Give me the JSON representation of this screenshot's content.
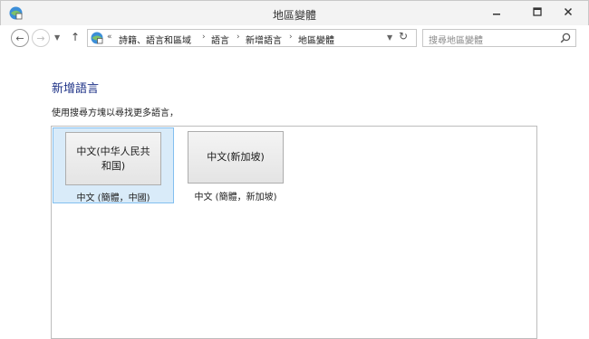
{
  "window": {
    "title": "地區變體"
  },
  "nav": {
    "crumbs": [
      "詩籍、語言和區域",
      "語言",
      "新增語言",
      "地區變體"
    ],
    "search_placeholder": "搜尋地區變體"
  },
  "content": {
    "heading": "新增語言",
    "instructions": "使用搜尋方塊以尋找更多語言，",
    "variants": [
      {
        "button_label": "中文(中华人民共和国)",
        "caption": "中文 (簡體，中國)",
        "selected": true
      },
      {
        "button_label": "中文(新加坡)",
        "caption": "中文 (簡體，新加坡)",
        "selected": false
      }
    ]
  },
  "colors": {
    "accent": "#1e3287",
    "selected_bg": "#d9ebf9",
    "selected_border": "#83bff0"
  }
}
